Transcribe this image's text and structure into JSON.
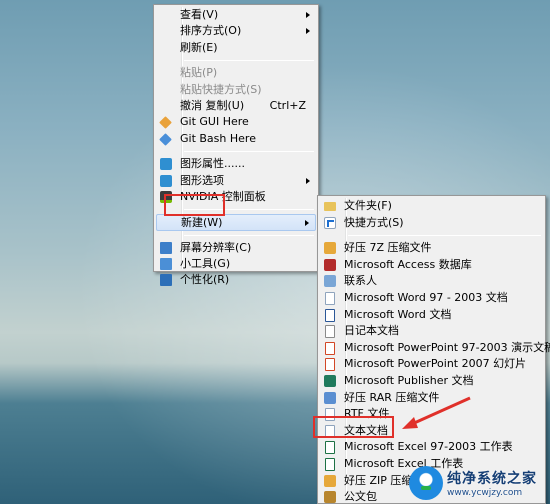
{
  "context_menu": {
    "items": [
      {
        "label": "查看(V)",
        "submenu": true
      },
      {
        "label": "排序方式(O)",
        "submenu": true
      },
      {
        "label": "刷新(E)"
      },
      {
        "separator": true
      },
      {
        "label": "粘贴(P)",
        "disabled": true
      },
      {
        "label": "粘贴快捷方式(S)",
        "disabled": true
      },
      {
        "label": "撤消 复制(U)",
        "shortcut": "Ctrl+Z"
      },
      {
        "label": "Git GUI Here",
        "icon": "git-gui-icon"
      },
      {
        "label": "Git Bash Here",
        "icon": "git-bash-icon"
      },
      {
        "separator": true
      },
      {
        "label": "图形属性......",
        "icon": "intel-graphics-icon"
      },
      {
        "label": "图形选项",
        "icon": "intel-graphics-options-icon",
        "submenu": true
      },
      {
        "label": "NVIDIA 控制面板",
        "icon": "nvidia-icon"
      },
      {
        "separator": true
      },
      {
        "label": "新建(W)",
        "submenu": true,
        "active": true
      },
      {
        "separator": true
      },
      {
        "label": "屏幕分辨率(C)",
        "icon": "display-icon"
      },
      {
        "label": "小工具(G)",
        "icon": "gadgets-icon"
      },
      {
        "label": "个性化(R)",
        "icon": "personalize-icon"
      }
    ]
  },
  "new_submenu": {
    "items": [
      {
        "label": "文件夹(F)",
        "icon": "folder-icon"
      },
      {
        "label": "快捷方式(S)",
        "icon": "shortcut-icon"
      },
      {
        "separator": true
      },
      {
        "label": "好压 7Z 压缩文件",
        "icon": "haozip-7z-icon"
      },
      {
        "label": "Microsoft Access 数据库",
        "icon": "access-icon"
      },
      {
        "label": "联系人",
        "icon": "contact-icon"
      },
      {
        "label": "Microsoft Word 97 - 2003 文档",
        "icon": "word-97-icon"
      },
      {
        "label": "Microsoft Word 文档",
        "icon": "word-icon"
      },
      {
        "label": "日记本文档",
        "icon": "journal-icon"
      },
      {
        "label": "Microsoft PowerPoint 97-2003 演示文稿",
        "icon": "powerpoint-97-icon"
      },
      {
        "label": "Microsoft PowerPoint 2007 幻灯片",
        "icon": "powerpoint-icon"
      },
      {
        "label": "Microsoft Publisher 文档",
        "icon": "publisher-icon"
      },
      {
        "label": "好压 RAR 压缩文件",
        "icon": "haozip-rar-icon"
      },
      {
        "label": "RTF 文件",
        "icon": "rtf-icon"
      },
      {
        "label": "文本文档",
        "icon": "text-document-icon"
      },
      {
        "label": "Microsoft Excel 97-2003 工作表",
        "icon": "excel-97-icon"
      },
      {
        "label": "Microsoft Excel 工作表",
        "icon": "excel-icon"
      },
      {
        "label": "好压 ZIP 压缩文件",
        "icon": "haozip-zip-icon"
      },
      {
        "label": "公文包",
        "icon": "briefcase-icon"
      }
    ]
  },
  "watermark": {
    "title": "纯净系统之家",
    "url": "www.ycwjzy.com"
  },
  "colors": {
    "highlight_box": "#e0302a",
    "menu_background": "#f0f0f0"
  }
}
